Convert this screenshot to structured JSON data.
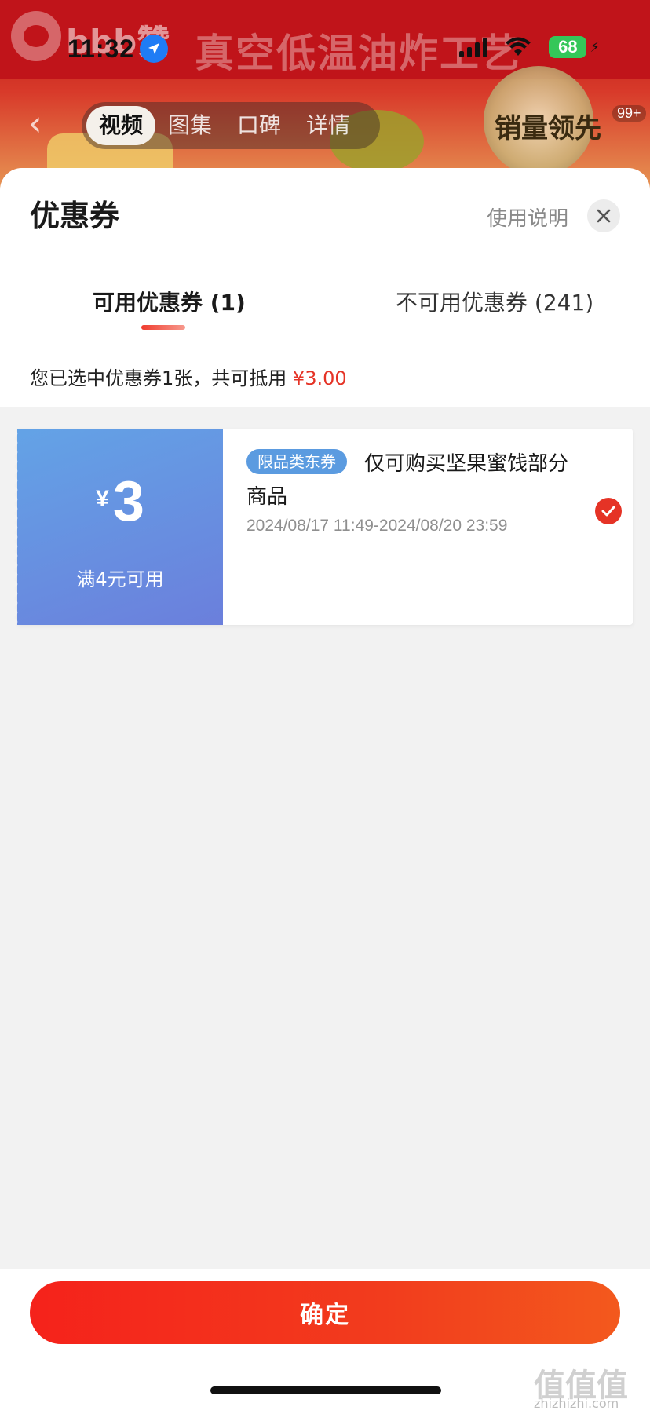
{
  "status_bar": {
    "time": "11:32",
    "battery": "68"
  },
  "background_page": {
    "banner_brand": "bbb赞",
    "banner_title": "真空低温油炸工艺",
    "tabs": [
      "视频",
      "图集",
      "口碑",
      "详情"
    ],
    "medal_text": "销量领先",
    "badge": "99+"
  },
  "sheet": {
    "title": "优惠券",
    "help_link": "使用说明",
    "tabs": [
      {
        "label": "可用优惠券 (1)"
      },
      {
        "label": "不可用优惠券 (241)"
      }
    ],
    "summary_prefix": "您已选中优惠券1张，共可抵用",
    "summary_amount": "¥3.00"
  },
  "coupons": [
    {
      "currency": "¥",
      "amount": "3",
      "condition": "满4元可用",
      "tag": "限品类东券",
      "description": "仅可购买坚果蜜饯部分商品",
      "validity": "2024/08/17 11:49-2024/08/20 23:59",
      "selected": true
    }
  ],
  "footer": {
    "confirm_label": "确定",
    "watermark": "值值值",
    "watermark_site": "zhizhizhi.com"
  },
  "colors": {
    "accent_red": "#e53326",
    "coupon_blue_start": "#63a3e6",
    "coupon_blue_end": "#6b7fdc",
    "tag_blue": "#5b9be0"
  }
}
